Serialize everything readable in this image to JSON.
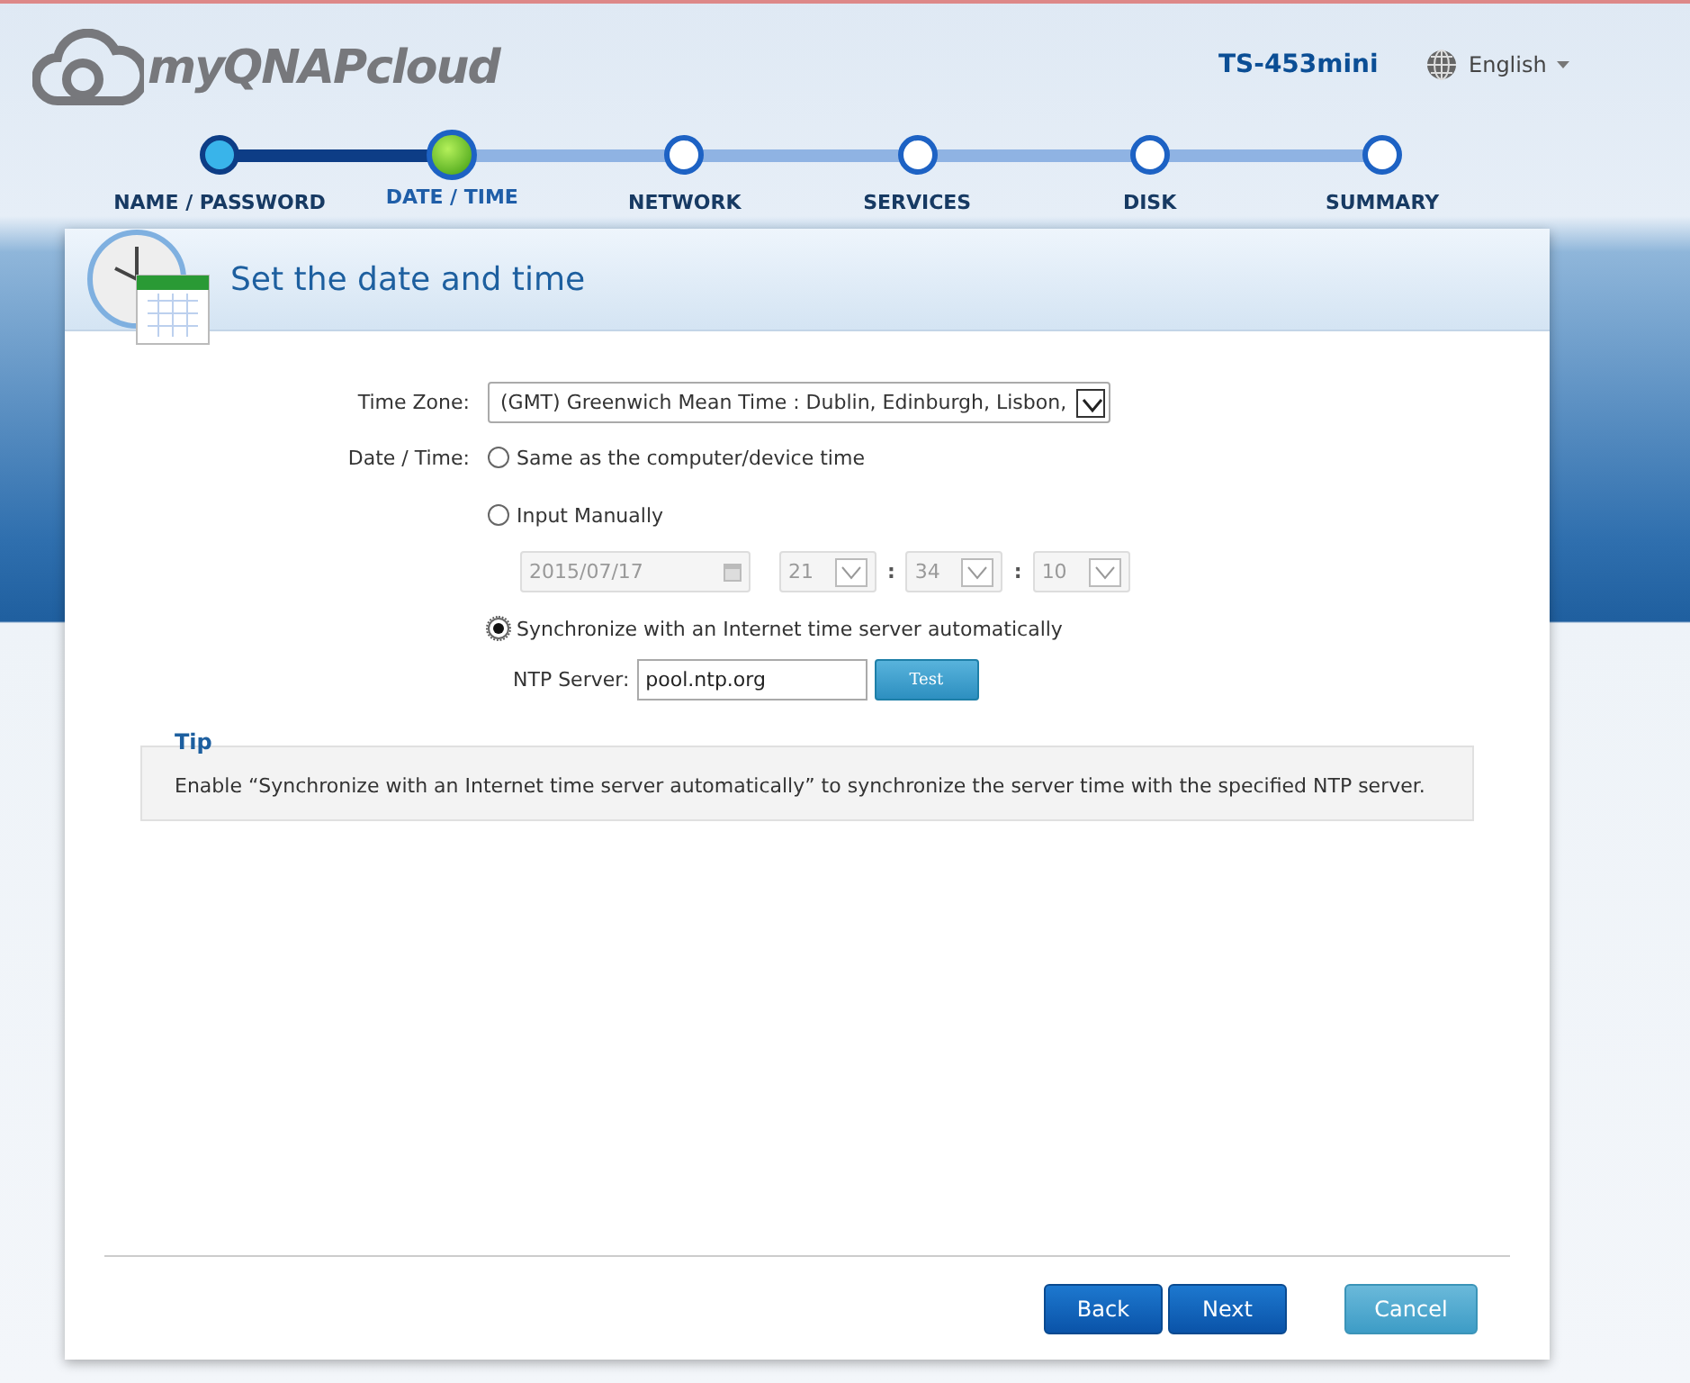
{
  "header": {
    "logo": "myQNAPcloud",
    "device": "TS-453mini",
    "language": "English"
  },
  "steps": [
    {
      "label": "NAME / PASSWORD",
      "done": true,
      "selected": false
    },
    {
      "label": "DATE / TIME",
      "done": false,
      "selected": true
    },
    {
      "label": "NETWORK",
      "done": false,
      "selected": false
    },
    {
      "label": "SERVICES",
      "done": false,
      "selected": false
    },
    {
      "label": "DISK",
      "done": false,
      "selected": false
    },
    {
      "label": "SUMMARY",
      "done": false,
      "selected": false
    }
  ],
  "panel": {
    "title": "Set the date and time"
  },
  "form": {
    "time_zone_label": "Time Zone:",
    "time_zone": "(GMT) Greenwich Mean Time : Dublin, Edinburgh, Lisbon,",
    "date_time_label": "Date / Time:",
    "options": [
      {
        "label": "Same as the computer/device time",
        "selected": false
      },
      {
        "label": "Input Manually",
        "selected": false
      },
      {
        "label": "Synchronize with an Internet time server automatically",
        "selected": true
      }
    ],
    "manual": {
      "disabled": true,
      "date": "2015/07/17",
      "hour": "21",
      "minute": "34",
      "second": "10",
      "separators": [
        ":",
        ":"
      ]
    },
    "ntp_label": "NTP Server:",
    "ntp_server": "pool.ntp.org",
    "test_button": "Test"
  },
  "tip": {
    "title": "Tip",
    "text": "Enable “Synchronize with an Internet time server automatically” to synchronize the server time with the specified NTP server."
  },
  "buttons": [
    {
      "label": "Back",
      "kind": "primary"
    },
    {
      "label": "Next",
      "kind": "primary"
    },
    {
      "label": "Cancel",
      "kind": "secondary"
    }
  ]
}
